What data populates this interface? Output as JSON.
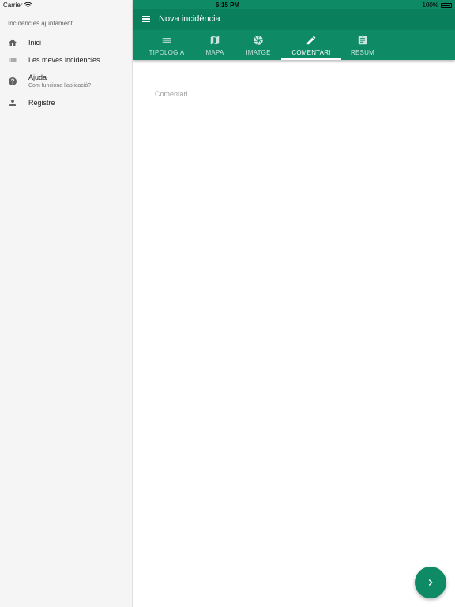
{
  "status_bar": {
    "carrier": "Carrier",
    "time": "6:15 PM",
    "battery": "100%"
  },
  "sidebar": {
    "header": "Incidències ajuntament",
    "items": [
      {
        "label": "Inici",
        "icon": "home-icon"
      },
      {
        "label": "Les meves incidències",
        "icon": "list-icon"
      },
      {
        "label": "Ajuda",
        "sublabel": "Com funciona l'aplicació?",
        "icon": "help-icon"
      },
      {
        "label": "Registre",
        "icon": "person-icon"
      }
    ]
  },
  "appbar": {
    "title": "Nova incidència",
    "color": "#0e8a64"
  },
  "tabs": [
    {
      "label": "TIPOLOGIA",
      "icon": "list-icon",
      "active": false
    },
    {
      "label": "MAPA",
      "icon": "map-icon",
      "active": false
    },
    {
      "label": "IMATGE",
      "icon": "camera-shutter-icon",
      "active": false
    },
    {
      "label": "COMENTARI",
      "icon": "pencil-icon",
      "active": true
    },
    {
      "label": "RESUM",
      "icon": "clipboard-icon",
      "active": false
    }
  ],
  "comment": {
    "label": "Comentari",
    "value": ""
  },
  "fab": {
    "icon": "chevron-right-icon"
  }
}
